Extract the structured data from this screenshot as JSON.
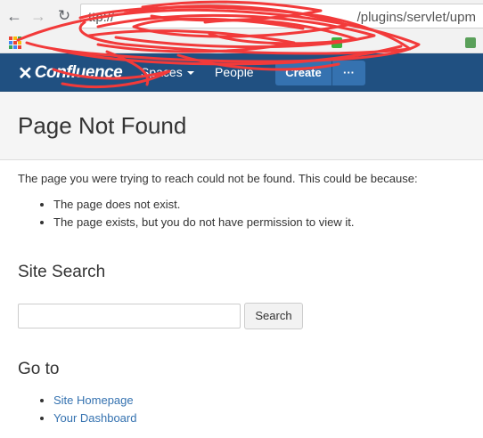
{
  "browser": {
    "back_glyph": "←",
    "forward_glyph": "→",
    "reload_glyph": "↻",
    "url_visible": "ttp://",
    "url_tail": "/plugins/servlet/upm"
  },
  "app_header": {
    "logo_text": "Confluence",
    "logo_icon": "confluence-x-icon",
    "spaces_label": "Spaces",
    "people_label": "People",
    "create_label": "Create",
    "create_more_label": "···",
    "colors": {
      "header_bg": "#205081",
      "button_bg": "#3572b0"
    }
  },
  "page": {
    "title": "Page Not Found",
    "intro": "The page you were trying to reach could not be found. This could be because:",
    "reasons": [
      "The page does not exist.",
      "The page exists, but you do not have permission to view it."
    ]
  },
  "site_search": {
    "title": "Site Search",
    "input_value": "",
    "button_label": "Search"
  },
  "goto": {
    "title": "Go to",
    "links": [
      "Site Homepage",
      "Your Dashboard"
    ],
    "link_color": "#3572b0"
  }
}
